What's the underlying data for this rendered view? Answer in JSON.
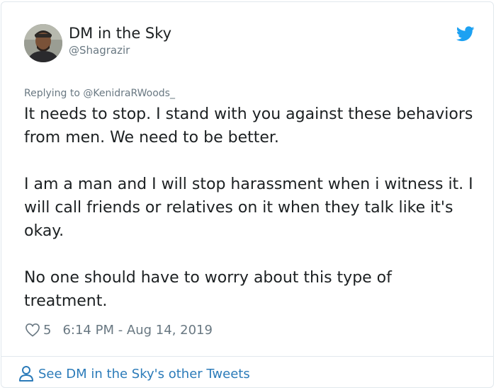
{
  "author": {
    "display_name": "DM in the Sky",
    "handle": "@Shagrazir",
    "avatar_icon": "profile-photo"
  },
  "brand_icon": "twitter-bird-icon",
  "colors": {
    "twitter_blue": "#1da1f2",
    "link": "#2b7bb9",
    "secondary_text": "#697882",
    "primary_text": "#1c2022",
    "border": "#e1e8ed"
  },
  "tweet": {
    "replying_to": "Replying to @KenidraRWoods_",
    "paragraphs": [
      "It needs to stop. I stand with you against these behaviors from men. We need to be better.",
      "I am a man and I will stop harassment when i witness it. I will call friends or relatives on it when they talk like it's okay.",
      "No one should have to worry about this type of treatment."
    ],
    "likes": "5",
    "timestamp": "6:14 PM - Aug 14, 2019"
  },
  "footer": {
    "see_more_label": "See DM in the Sky's other Tweets"
  }
}
